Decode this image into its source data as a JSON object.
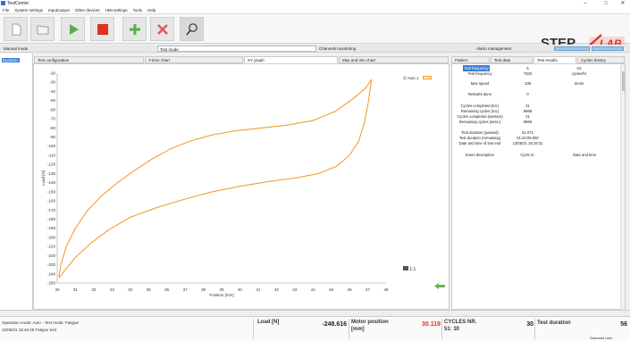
{
  "window": {
    "title": "TestCenter",
    "minimize": "–",
    "maximize": "□",
    "close": "✕"
  },
  "menu": [
    "File",
    "System settings",
    "Input/output",
    "Other devices",
    "HMI settings",
    "Tools",
    "Help"
  ],
  "toolbar": {
    "buttons": [
      "new-file-icon",
      "open-folder-icon",
      "play-icon",
      "stop-icon",
      "add-icon",
      "delete-icon",
      "search-icon"
    ],
    "colors": {
      "play": "#57b04a",
      "stop": "#e2321f",
      "add": "#57b04a",
      "delete": "#e05a5a"
    }
  },
  "logo": {
    "text_left": "STEP",
    "text_right": "LAB",
    "accent": "#e2321f"
  },
  "sections": {
    "manual": "Manual mode",
    "test": "Test mode",
    "channels": "Channels monitoring",
    "alarm": "Alarm management"
  },
  "left_panel": {
    "selected": "Dynamic"
  },
  "chart_tabs": [
    "Test configuration",
    "Y-time chart",
    "XY graph",
    "Max and min chart"
  ],
  "right_tabs": [
    "Pattern",
    "Test data",
    "Test results",
    "Cycles history"
  ],
  "legend": {
    "label": "Axis 1",
    "checked": "☑"
  },
  "zoom_label": "1:1",
  "results": [
    {
      "label": "Test frequency",
      "value": "5",
      "unit": "Hz"
    },
    {
      "label": "Test frequency",
      "value": "7200",
      "unit": "cycles/hr"
    },
    {
      "label": "Max speed",
      "value": "108",
      "unit": "mm/s"
    },
    {
      "label": "Restarts done",
      "value": "0",
      "unit": ""
    },
    {
      "label": "Cycles completed (tot.)",
      "value": "31",
      "unit": ""
    },
    {
      "label": "Remaining cycles (tot.)",
      "value": "9969",
      "unit": ""
    },
    {
      "label": "Cycles completed (session)",
      "value": "31",
      "unit": ""
    },
    {
      "label": "Remaining cycles (sess.)",
      "value": "9969",
      "unit": ""
    },
    {
      "label": "Test duration (passed)",
      "value": "51.071",
      "unit": ""
    },
    {
      "label": "Test duration (remaining)",
      "value": "01:23:08.000",
      "unit": ""
    },
    {
      "label": "Date and time of test end",
      "value": "13/05/21 18:18:31",
      "unit": ""
    }
  ],
  "events_header": {
    "description": "Event description",
    "cycle": "Cycle nr.",
    "date": "Date and time"
  },
  "status": {
    "mode": "Operation mode: Auto - Test mode: Fatigue",
    "datetime": "12/05/21 16:46:25 Fatigue test",
    "load_label": "Load [N]",
    "load_value": "-248.616",
    "motor_label": "Motor position",
    "motor_unit": "[mm]",
    "motor_value": "30.119",
    "cycles_label": "CYCLES NR.",
    "cycles_sub": "51: 30",
    "cycles_value": "30",
    "duration_label": "Test duration",
    "duration_value": "56",
    "footer": "Standard user"
  },
  "chart_data": {
    "type": "line",
    "title": "",
    "xlabel": "Position [mm]",
    "ylabel": "Load [N]",
    "xlim": [
      30,
      48
    ],
    "ylim": [
      -250,
      -20
    ],
    "xticks": [
      30,
      31,
      32,
      33,
      34,
      35,
      36,
      37,
      38,
      39,
      40,
      41,
      42,
      43,
      44,
      45,
      46,
      47,
      48
    ],
    "yticks": [
      -20,
      -30,
      -40,
      -50,
      -60,
      -70,
      -80,
      -90,
      -100,
      -110,
      -120,
      -130,
      -140,
      -150,
      -160,
      -170,
      -180,
      -190,
      -200,
      -210,
      -220,
      -230,
      -240,
      -250
    ],
    "grid": false,
    "series": [
      {
        "name": "Axis 1",
        "color": "#f0a030",
        "x": [
          30.1,
          30.2,
          30.5,
          31,
          31.6,
          32.4,
          33.3,
          34.2,
          35.2,
          36.2,
          37.2,
          38.4,
          39.8,
          41.2,
          42.6,
          44,
          45.2,
          46.2,
          46.9,
          47.2,
          47.15,
          47,
          46.8,
          46.5,
          46,
          45.3,
          44.3,
          43,
          41.5,
          40,
          38.5,
          37,
          35.5,
          34,
          32.8,
          31.8,
          31,
          30.5,
          30.2,
          30.1
        ],
        "y": [
          -243,
          -230,
          -210,
          -190,
          -172,
          -155,
          -140,
          -127,
          -114,
          -103,
          -95,
          -88,
          -83,
          -80,
          -77,
          -72,
          -62,
          -48,
          -36,
          -27,
          -35,
          -55,
          -75,
          -95,
          -110,
          -122,
          -130,
          -135,
          -139,
          -144,
          -150,
          -158,
          -167,
          -178,
          -192,
          -207,
          -222,
          -234,
          -242,
          -244
        ]
      }
    ]
  }
}
